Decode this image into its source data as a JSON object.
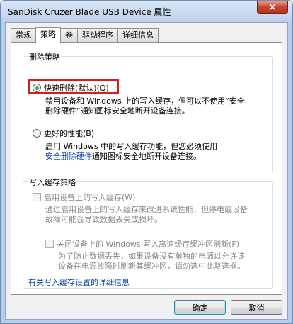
{
  "window": {
    "title": "SanDisk Cruzer Blade USB Device 属性",
    "close_icon": "×"
  },
  "tabs": [
    {
      "label": "常规",
      "active": false
    },
    {
      "label": "策略",
      "active": true
    },
    {
      "label": "卷",
      "active": false
    },
    {
      "label": "驱动程序",
      "active": false
    },
    {
      "label": "详细信息",
      "active": false
    }
  ],
  "removal_policy": {
    "legend": "删除策略",
    "quick_removal": {
      "label": "快速删除(默认)(Q)",
      "selected": true,
      "desc_line1": "禁用设备和 Windows 上的写入缓存，但可以不使用“安全",
      "desc_line2": "删除硬件”通知图标安全地断开设备连接。"
    },
    "better_performance": {
      "label": "更好的性能(B)",
      "selected": false,
      "desc_line1": "启用 Windows 中的写入缓存功能，但您必须使用",
      "desc_link": "安全删除硬件",
      "desc_line2_rest": "通知图标安全地断开设备连接。"
    }
  },
  "write_cache": {
    "legend": "写入缓存策略",
    "enable_cache": {
      "label": "启用设备上的写入缓存(W)",
      "desc_line1": "通过启用设备上的写入缓存来改进系统性能，但停电或设备",
      "desc_line2": "故障可能会导致数据丢失或损坏。"
    },
    "disable_flush": {
      "label": "关闭设备上的 Windows 写入高速缓存缓冲区刷新(F)",
      "desc_line1": "为了防止数据丢失，如果设备没有单独的电源以允许该",
      "desc_line2": "设备在电源故障时刷新其缓冲区，请勿选中此复选框。"
    },
    "details_link": "有关写入缓存设置的详细信息"
  },
  "buttons": {
    "ok": "确定",
    "cancel": "取消"
  }
}
